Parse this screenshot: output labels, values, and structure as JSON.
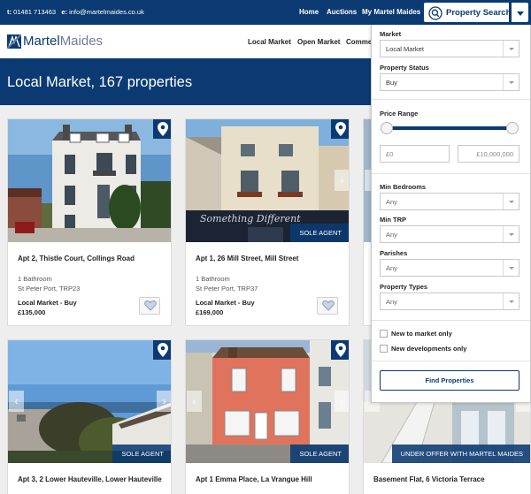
{
  "topbar": {
    "phone_prefix": "t:",
    "phone": "01481 713463",
    "email_prefix": "e:",
    "email": "info@martelmaides.co.uk",
    "nav": [
      "Home",
      "Auctions",
      "My Martel Maides"
    ],
    "property_search_label": "Property Search"
  },
  "header": {
    "logo_bold": "Martel",
    "logo_light": "Maides",
    "nav": [
      "Local Market",
      "Open Market",
      "Comme"
    ]
  },
  "banner": {
    "title": "Local Market, 167 properties"
  },
  "listings": [
    {
      "title": "Apt 2, Thistle Court, Collings Road",
      "detail": "1 Bathroom",
      "location": "St Peter Port, TRP23",
      "status": "Local Market - Buy",
      "price": "£135,000",
      "tag": ""
    },
    {
      "title": "Apt 1, 26 Mill Street, Mill Street",
      "detail": "1 Bathroom",
      "location": "St Peter Port, TRP37",
      "status": "Local Market - Buy",
      "price": "£169,000",
      "tag": "SOLE AGENT",
      "shop_sign": "Something Different"
    },
    {
      "title": "Apt 3, 2 Lower Hauteville, Lower Hauteville",
      "tag": "SOLE AGENT"
    },
    {
      "title": "Apt 1 Emma Place, La Vrangue Hill",
      "tag": "SOLE AGENT"
    },
    {
      "title": "Basement Flat, 6 Victoria Terrace",
      "tag": "UNDER OFFER WITH MARTEL MAIDES"
    }
  ],
  "filters": {
    "market": {
      "label": "Market",
      "value": "Local Market"
    },
    "property_status": {
      "label": "Property Status",
      "value": "Buy"
    },
    "price_range": {
      "label": "Price Range",
      "min": "£0",
      "max": "£10,000,000"
    },
    "min_bedrooms": {
      "label": "Min Bedrooms",
      "value": "Any"
    },
    "min_trp": {
      "label": "Min TRP",
      "value": "Any"
    },
    "parishes": {
      "label": "Parishes",
      "value": "Any"
    },
    "property_types": {
      "label": "Property Types",
      "value": "Any"
    },
    "new_to_market": "New to market only",
    "new_developments": "New developments only",
    "find_button": "Find Properties"
  },
  "colors": {
    "brand_navy": "#0b3a73",
    "page_bg": "#eeeeee"
  }
}
